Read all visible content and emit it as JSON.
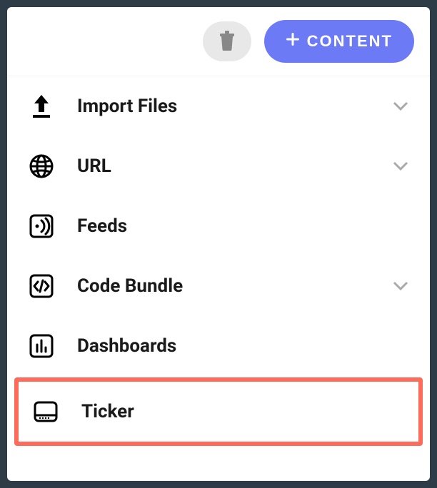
{
  "toolbar": {
    "content_button_label": "CONTENT"
  },
  "menu": {
    "items": [
      {
        "id": "import-files",
        "label": "Import Files",
        "expandable": true
      },
      {
        "id": "url",
        "label": "URL",
        "expandable": true
      },
      {
        "id": "feeds",
        "label": "Feeds",
        "expandable": false
      },
      {
        "id": "code-bundle",
        "label": "Code Bundle",
        "expandable": true
      },
      {
        "id": "dashboards",
        "label": "Dashboards",
        "expandable": false
      },
      {
        "id": "ticker",
        "label": "Ticker",
        "expandable": false,
        "highlighted": true
      }
    ]
  },
  "colors": {
    "primary": "#6d7af6",
    "highlight_border": "#ff6b5b"
  }
}
